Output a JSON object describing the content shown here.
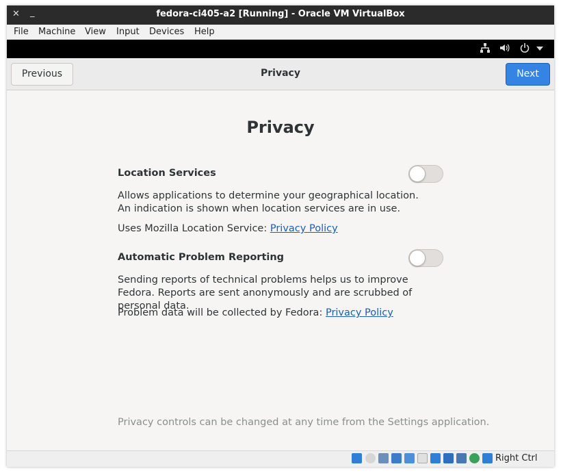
{
  "window": {
    "title": "fedora-ci405-a2 [Running] - Oracle VM VirtualBox",
    "close_glyph": "✕",
    "minimize_glyph": "‗"
  },
  "menubar": {
    "items": [
      "File",
      "Machine",
      "View",
      "Input",
      "Devices",
      "Help"
    ]
  },
  "vm_toolbar": {
    "icons": [
      "network-icon",
      "volume-icon",
      "power-icon",
      "dropdown-arrow-icon"
    ]
  },
  "header": {
    "previous_label": "Previous",
    "title": "Privacy",
    "next_label": "Next"
  },
  "page": {
    "heading": "Privacy",
    "location": {
      "label": "Location Services",
      "enabled": false,
      "description": "Allows applications to determine your geographical location. An indication is shown when location services are in use.",
      "policy_prefix": "Uses Mozilla Location Service: ",
      "policy_link": "Privacy Policy"
    },
    "reporting": {
      "label": "Automatic Problem Reporting",
      "enabled": false,
      "description": "Sending reports of technical problems helps us to improve Fedora. Reports are sent anonymously and are scrubbed of personal data.",
      "policy_prefix": "Problem data will be collected by Fedora: ",
      "policy_link": "Privacy Policy"
    },
    "footer_note": "Privacy controls can be changed at any time from the Settings application."
  },
  "statusbar": {
    "host_key": "Right Ctrl",
    "icons": [
      "hard-disk-icon",
      "optical-drive-icon",
      "audio-icon",
      "network-adapter-icon",
      "usb-icon",
      "shared-folder-icon",
      "display-icon",
      "video-capture-icon",
      "mouse-integration-icon",
      "cpu-icon",
      "keyboard-icon"
    ]
  },
  "colors": {
    "accent": "#3584e4",
    "link": "#1a5fb4",
    "titlebar": "#2b2b2b"
  }
}
